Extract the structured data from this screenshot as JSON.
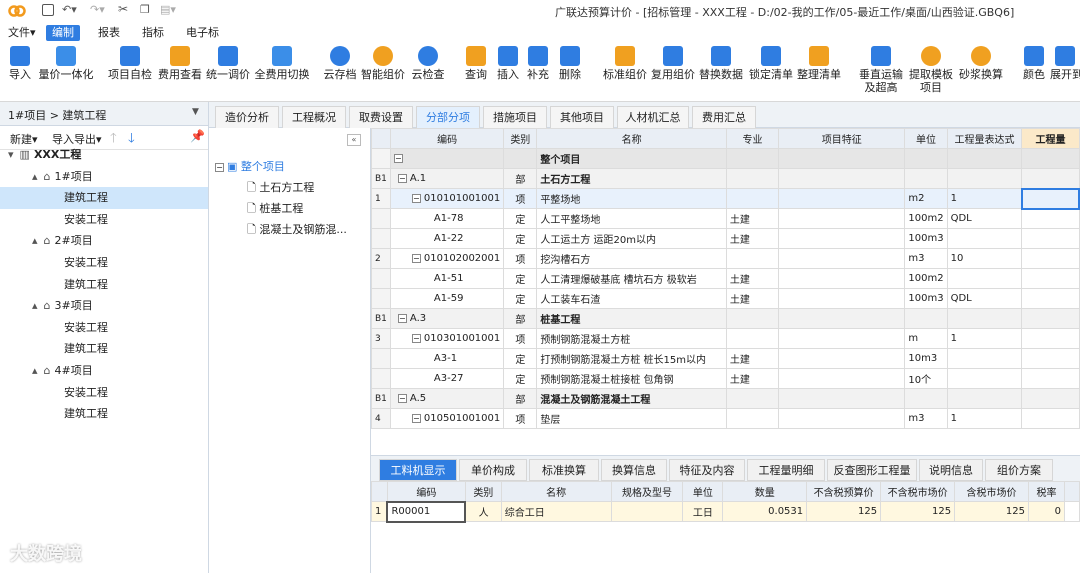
{
  "title_bar": {
    "title": "广联达预算计价 - [招标管理 - XXX工程 - D:/02-我的工作/05-最近工作/桌面/山西验证.GBQ6]"
  },
  "menu": {
    "file": "文件▾",
    "edit": "编制",
    "report": "报表",
    "index": "指标",
    "etender": "电子标"
  },
  "toolbar": {
    "import": "导入",
    "price_unify": "量价一体化",
    "self_check": "项目自检",
    "fee_view": "费用查看",
    "unify_adjust": "统一调价",
    "fee_switch": "全费用切换",
    "cloud_save": "云存档",
    "smart_price": "智能组价",
    "cloud_check": "云检查",
    "query": "查询",
    "insert": "插入",
    "supplement": "补充",
    "delete": "删除",
    "std_price": "标准组价",
    "copy_price": "复用组价",
    "replace_data": "替换数据",
    "lock_list": "锁定清单",
    "sort_list": "整理清单",
    "vertical": "垂直运输",
    "vertical2": "及超高",
    "template": "提取模板",
    "template2": "项目",
    "mortar": "砂浆换算",
    "color": "颜色",
    "expand": "展开到"
  },
  "breadcrumb": "1#项目 > 建筑工程",
  "left_panel": {
    "new_btn": "新建▾",
    "import_export": "导入导出▾",
    "tree": [
      {
        "label": "XXX工程",
        "level": 0
      },
      {
        "label": "1#项目",
        "level": 1
      },
      {
        "label": "建筑工程",
        "level": 2
      },
      {
        "label": "安装工程",
        "level": 2
      },
      {
        "label": "2#项目",
        "level": 1
      },
      {
        "label": "安装工程",
        "level": 2
      },
      {
        "label": "建筑工程",
        "level": 2
      },
      {
        "label": "3#项目",
        "level": 1
      },
      {
        "label": "安装工程",
        "level": 2
      },
      {
        "label": "建筑工程",
        "level": 2
      },
      {
        "label": "4#项目",
        "level": 1
      },
      {
        "label": "安装工程",
        "level": 2
      },
      {
        "label": "建筑工程",
        "level": 2
      }
    ]
  },
  "tabs": [
    "造价分析",
    "工程概况",
    "取费设置",
    "分部分项",
    "措施项目",
    "其他项目",
    "人材机汇总",
    "费用汇总"
  ],
  "mid_tree": {
    "root": "整个项目",
    "items": [
      "土石方工程",
      "桩基工程",
      "混凝土及钢筋混..."
    ]
  },
  "grid": {
    "headers": [
      "",
      "编码",
      "类别",
      "名称",
      "专业",
      "项目特征",
      "单位",
      "工程量表达式",
      "工程量"
    ],
    "rows": [
      {
        "type": "grp",
        "seq": "",
        "code": "",
        "cat": "",
        "name": "整个项目",
        "prof": "",
        "feat": "",
        "unit": "",
        "expr": ""
      },
      {
        "type": "sub",
        "seq": "B1",
        "code": "A.1",
        "cat": "部",
        "name": "土石方工程",
        "prof": "",
        "feat": "",
        "unit": "",
        "expr": ""
      },
      {
        "type": "itm",
        "seq": "1",
        "code": "010101001001",
        "cat": "项",
        "name": "平整场地",
        "prof": "",
        "feat": "",
        "unit": "m2",
        "expr": "1"
      },
      {
        "type": "def",
        "seq": "",
        "code": "A1-78",
        "cat": "定",
        "name": "人工平整场地",
        "prof": "土建",
        "feat": "",
        "unit": "100m2",
        "expr": "QDL"
      },
      {
        "type": "def",
        "seq": "",
        "code": "A1-22",
        "cat": "定",
        "name": "人工运土方 运距20m以内",
        "prof": "土建",
        "feat": "",
        "unit": "100m3",
        "expr": ""
      },
      {
        "type": "itm2",
        "seq": "2",
        "code": "010102002001",
        "cat": "项",
        "name": "挖沟槽石方",
        "prof": "",
        "feat": "",
        "unit": "m3",
        "expr": "10"
      },
      {
        "type": "def",
        "seq": "",
        "code": "A1-51",
        "cat": "定",
        "name": "人工清理爆破基底 槽坑石方 极软岩",
        "prof": "土建",
        "feat": "",
        "unit": "100m2",
        "expr": ""
      },
      {
        "type": "def",
        "seq": "",
        "code": "A1-59",
        "cat": "定",
        "name": "人工装车石渣",
        "prof": "土建",
        "feat": "",
        "unit": "100m3",
        "expr": "QDL"
      },
      {
        "type": "sub",
        "seq": "B1",
        "code": "A.3",
        "cat": "部",
        "name": "桩基工程",
        "prof": "",
        "feat": "",
        "unit": "",
        "expr": ""
      },
      {
        "type": "itm2",
        "seq": "3",
        "code": "010301001001",
        "cat": "项",
        "name": "预制钢筋混凝土方桩",
        "prof": "",
        "feat": "",
        "unit": "m",
        "expr": "1"
      },
      {
        "type": "def",
        "seq": "",
        "code": "A3-1",
        "cat": "定",
        "name": "打预制钢筋混凝土方桩 桩长15m以内",
        "prof": "土建",
        "feat": "",
        "unit": "10m3",
        "expr": ""
      },
      {
        "type": "def",
        "seq": "",
        "code": "A3-27",
        "cat": "定",
        "name": "预制钢筋混凝土桩接桩 包角钢",
        "prof": "土建",
        "feat": "",
        "unit": "10个",
        "expr": ""
      },
      {
        "type": "sub",
        "seq": "B1",
        "code": "A.5",
        "cat": "部",
        "name": "混凝土及钢筋混凝土工程",
        "prof": "",
        "feat": "",
        "unit": "",
        "expr": ""
      },
      {
        "type": "itm2",
        "seq": "4",
        "code": "010501001001",
        "cat": "项",
        "name": "垫层",
        "prof": "",
        "feat": "",
        "unit": "m3",
        "expr": "1"
      }
    ]
  },
  "bottom_tabs": [
    "工料机显示",
    "单价构成",
    "标准换算",
    "换算信息",
    "特征及内容",
    "工程量明细",
    "反查图形工程量",
    "说明信息",
    "组价方案"
  ],
  "bottom_grid": {
    "headers": [
      "",
      "编码",
      "类别",
      "名称",
      "规格及型号",
      "单位",
      "数量",
      "不含税预算价",
      "不含税市场价",
      "含税市场价",
      "税率"
    ],
    "rows": [
      [
        "1",
        "R00001",
        "人",
        "综合工日",
        "",
        "工日",
        "0.0531",
        "125",
        "125",
        "125",
        "0"
      ]
    ]
  },
  "watermark": "大数跨境"
}
